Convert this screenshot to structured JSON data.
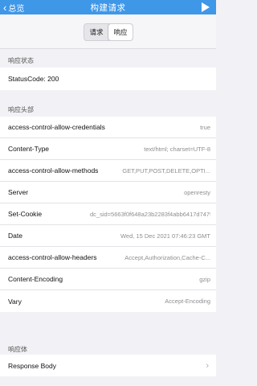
{
  "nav": {
    "back_label": "总览",
    "title": "构建请求"
  },
  "tabs": [
    {
      "label": "请求",
      "active": false
    },
    {
      "label": "响应",
      "active": true
    }
  ],
  "status_section": {
    "header": "响应状态",
    "status_text": "StatusCode: 200"
  },
  "headers_section": {
    "header": "响应头部",
    "rows": [
      {
        "key": "access-control-allow-credentials",
        "value": "true"
      },
      {
        "key": "Content-Type",
        "value": "text/html; charset=UTF-8"
      },
      {
        "key": "access-control-allow-methods",
        "value": "GET,PUT,POST,DELETE,OPTI..."
      },
      {
        "key": "Server",
        "value": "openresty"
      },
      {
        "key": "Set-Cookie",
        "value": "dc_sid=5663f0f648a23b2283f4abb6417d747f; F..."
      },
      {
        "key": "Date",
        "value": "Wed, 15 Dec 2021 07:46:23 GMT"
      },
      {
        "key": "access-control-allow-headers",
        "value": "Accept,Authorization,Cache-C..."
      },
      {
        "key": "Content-Encoding",
        "value": "gzip"
      },
      {
        "key": "Vary",
        "value": "Accept-Encoding"
      }
    ]
  },
  "body_section": {
    "header": "响应体",
    "row_label": "Response Body"
  },
  "colors": {
    "nav_background": "#3f97e8",
    "page_background": "#f2f2f6"
  },
  "icons": {
    "back": "chevron-left-icon",
    "play": "play-icon",
    "disclosure": "chevron-right-icon"
  }
}
